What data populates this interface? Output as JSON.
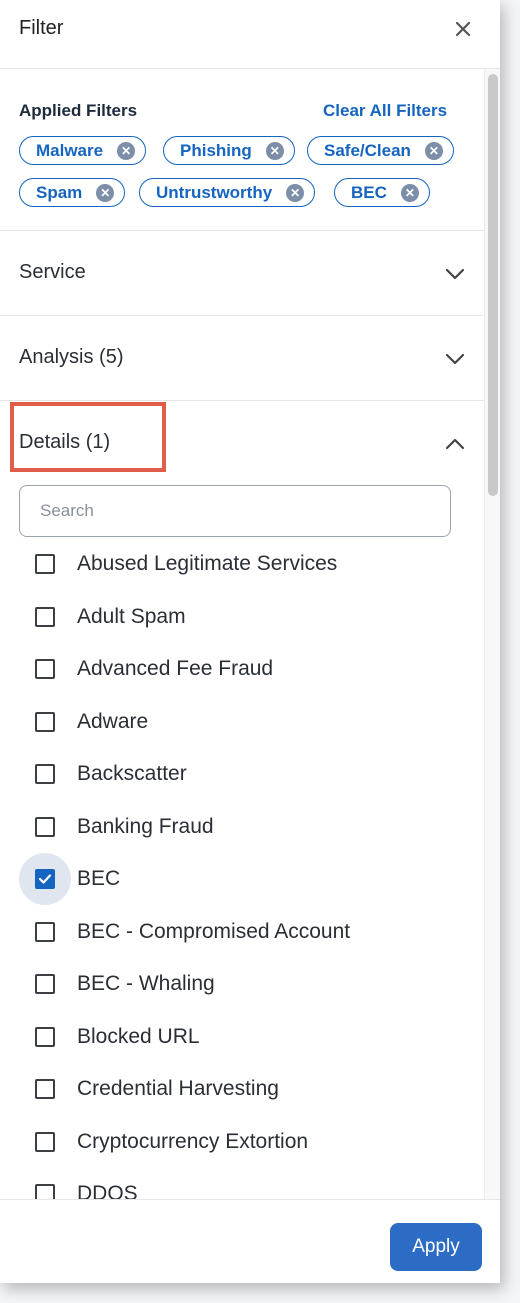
{
  "header": {
    "title": "Filter",
    "close_icon": "close-icon"
  },
  "applied": {
    "label": "Applied Filters",
    "clear_all": "Clear All Filters",
    "chips": [
      "Malware",
      "Phishing",
      "Safe/Clean",
      "Spam",
      "Untrustworthy",
      "BEC"
    ]
  },
  "sections": {
    "service": {
      "label": "Service",
      "expanded": false
    },
    "analysis": {
      "label": "Analysis (5)",
      "expanded": false
    },
    "details": {
      "label": "Details (1)",
      "expanded": true
    }
  },
  "details": {
    "search_placeholder": "Search",
    "options": [
      {
        "label": "Abused Legitimate Services",
        "checked": false
      },
      {
        "label": "Adult Spam",
        "checked": false
      },
      {
        "label": "Advanced Fee Fraud",
        "checked": false
      },
      {
        "label": "Adware",
        "checked": false
      },
      {
        "label": "Backscatter",
        "checked": false
      },
      {
        "label": "Banking Fraud",
        "checked": false
      },
      {
        "label": "BEC",
        "checked": true
      },
      {
        "label": "BEC - Compromised Account",
        "checked": false
      },
      {
        "label": "BEC - Whaling",
        "checked": false
      },
      {
        "label": "Blocked URL",
        "checked": false
      },
      {
        "label": "Credential Harvesting",
        "checked": false
      },
      {
        "label": "Cryptocurrency Extortion",
        "checked": false
      },
      {
        "label": "DDOS",
        "checked": false
      }
    ]
  },
  "footer": {
    "apply_label": "Apply"
  },
  "colors": {
    "accent": "#1565c0",
    "apply_bg": "#2d6cc5",
    "highlight": "#e05d4a"
  }
}
